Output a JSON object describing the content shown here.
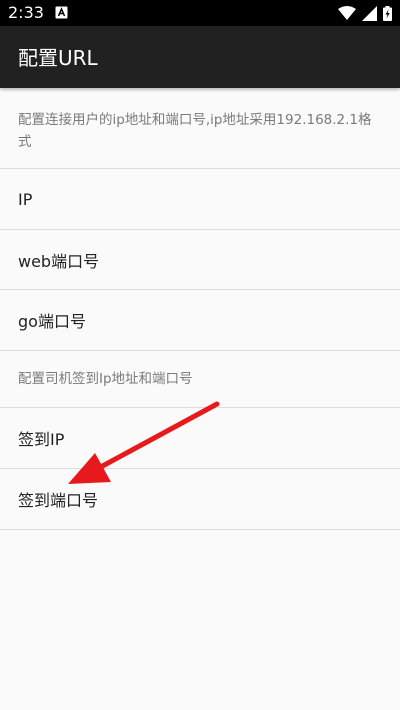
{
  "status_bar": {
    "time": "2:33",
    "icons": [
      "notification-a-icon",
      "wifi-icon",
      "signal-icon",
      "battery-charging-icon"
    ]
  },
  "app_bar": {
    "title": "配置URL"
  },
  "settings": {
    "category_1": "配置连接用户的ip地址和端口号,ip地址采用192.168.2.1格式",
    "ip_label": "IP",
    "web_port_label": "web端口号",
    "go_port_label": "go端口号",
    "category_2": "配置司机签到Ip地址和端口号",
    "sign_ip_label": "签到IP",
    "sign_port_label": "签到端口号"
  },
  "colors": {
    "status_bar": "#000000",
    "app_bar": "#212121",
    "background": "#fafafa",
    "divider": "#dedede",
    "annotation_arrow": "#e8191c"
  }
}
